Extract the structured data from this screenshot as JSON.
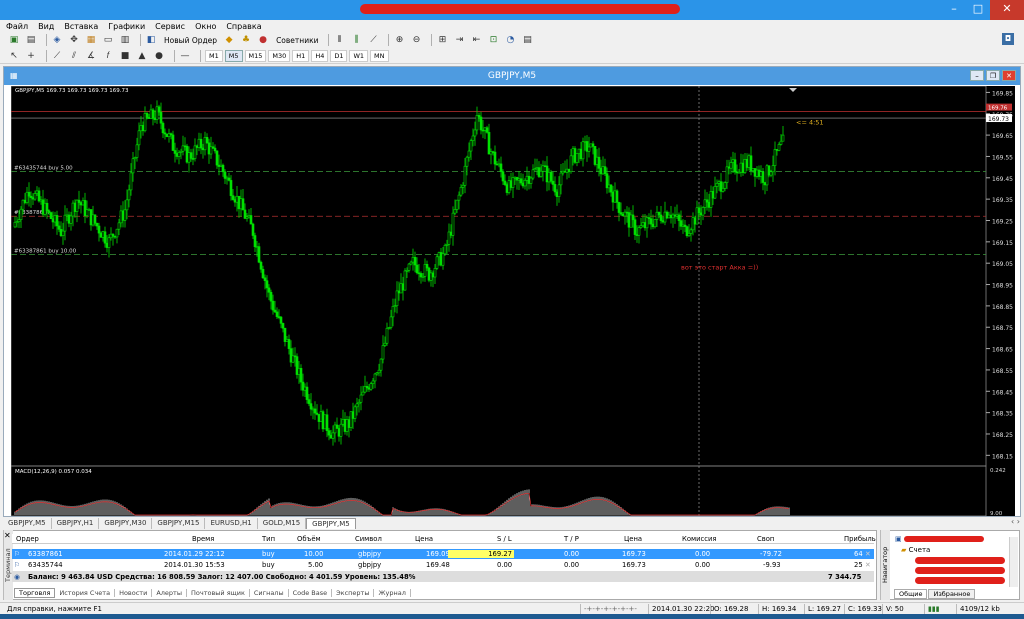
{
  "menu": [
    "Файл",
    "Вид",
    "Вставка",
    "Графики",
    "Сервис",
    "Окно",
    "Справка"
  ],
  "toolbar": {
    "new_order": "Новый Ордер",
    "experts": "Советники",
    "timeframes": [
      "M1",
      "M5",
      "M15",
      "M30",
      "H1",
      "H4",
      "D1",
      "W1",
      "MN"
    ],
    "active_tf": "M5"
  },
  "chart_window": {
    "title": "GBPJPY,M5",
    "info": "GBPJPY,M5  169.73 169.73 169.73 169.73",
    "indicator": "MACD(12,26,9) 0.057 0.034"
  },
  "chart_data": {
    "type": "candlestick",
    "symbol": "GBPJPY",
    "timeframe": "M5",
    "ylim": [
      168.1,
      169.88
    ],
    "price_ticks": [
      "169.85",
      "169.75",
      "169.65",
      "169.55",
      "169.45",
      "169.35",
      "169.25",
      "169.15",
      "169.05",
      "168.95",
      "168.85",
      "168.75",
      "168.65",
      "168.55",
      "168.45",
      "168.35",
      "168.25",
      "168.15"
    ],
    "price_ticks_values": [
      169.85,
      169.75,
      169.65,
      169.55,
      169.45,
      169.35,
      169.25,
      169.15,
      169.05,
      168.95,
      168.85,
      168.75,
      168.65,
      168.55,
      168.45,
      168.35,
      168.25,
      168.15
    ],
    "current_price": "169.73",
    "ask_label": "169.76",
    "lines": [
      {
        "price": 169.48,
        "label": "#63435744 buy 5.00",
        "color": "#3c9a3c"
      },
      {
        "price": 169.27,
        "label": "#6338786 sl",
        "color": "#b03030"
      },
      {
        "price": 169.09,
        "label": "#63387861 buy 10.00",
        "color": "#3c9a3c"
      },
      {
        "price": 169.76,
        "label": "",
        "color": "#c03030"
      }
    ],
    "close_path": [
      169.22,
      169.4,
      169.3,
      169.2,
      169.35,
      169.25,
      169.15,
      169.3,
      169.7,
      169.75,
      169.6,
      169.55,
      169.62,
      169.5,
      169.35,
      169.2,
      168.9,
      168.7,
      168.5,
      168.35,
      168.25,
      168.3,
      168.45,
      168.6,
      168.9,
      169.05,
      169.0,
      169.1,
      169.4,
      169.75,
      169.55,
      169.4,
      169.45,
      169.5,
      169.4,
      169.55,
      169.6,
      169.45,
      169.3,
      169.2,
      169.25,
      169.3,
      169.2,
      169.3,
      169.4,
      169.5,
      169.52,
      169.45,
      169.6,
      169.7
    ],
    "macd_ticks": [
      "0.242",
      "9.00"
    ],
    "annotation": "вот это старт Акка =))",
    "countdown": "<= 4:51"
  },
  "chart_tabs": [
    "GBPJPY,M5",
    "GBPJPY,H1",
    "GBPJPY,M30",
    "GBPJPY,M15",
    "EURUSD,H1",
    "GOLD,M15",
    "GBPJPY,M5"
  ],
  "active_chart_tab": 6,
  "terminal": {
    "label": "Терминал",
    "headers": {
      "order": "Ордер",
      "time": "Время",
      "type": "Тип",
      "volume": "Объём",
      "symbol": "Символ",
      "price": "Цена",
      "sl": "S / L",
      "tp": "T / P",
      "cur": "Цена",
      "comm": "Комиссия",
      "swap": "Своп",
      "profit": "Прибыль"
    },
    "rows": [
      {
        "order": "63387861",
        "time": "2014.01.29 22:12",
        "type": "buy",
        "volume": "10.00",
        "symbol": "gbpjpy",
        "price": "169.09",
        "sl": "169.27",
        "tp": "0.00",
        "cur": "169.73",
        "comm": "0.00",
        "swap": "-79.72",
        "profit": "64"
      },
      {
        "order": "63435744",
        "time": "2014.01.30 15:53",
        "type": "buy",
        "volume": "5.00",
        "symbol": "gbpjpy",
        "price": "169.48",
        "sl": "0.00",
        "tp": "0.00",
        "cur": "169.73",
        "comm": "0.00",
        "swap": "-9.93",
        "profit": "25"
      }
    ],
    "balance": "Баланс: 9 463.84 USD  Средства: 16 808.59  Залог: 12 407.00  Свободно: 4 401.59  Уровень: 135.48%",
    "balance_profit": "7 344.75",
    "tabs": [
      "Торговля",
      "История Счета",
      "Новости",
      "Алерты",
      "Почтовый ящик",
      "Сигналы",
      "Code Base",
      "Эксперты",
      "Журнал"
    ]
  },
  "navigator": {
    "label": "Навигатор",
    "root": "Счета",
    "tabs": [
      "Общие",
      "Избранное"
    ]
  },
  "status": {
    "help": "Для справки, нажмите F1",
    "profile": "-+-+-+-+-+-+-",
    "datetime": "2014.01.30 22:20",
    "open": "O: 169.28",
    "high": "H: 169.34",
    "low": "L: 169.27",
    "close": "C: 169.33",
    "volume": "V: 50",
    "traffic": "4109/12 kb"
  }
}
